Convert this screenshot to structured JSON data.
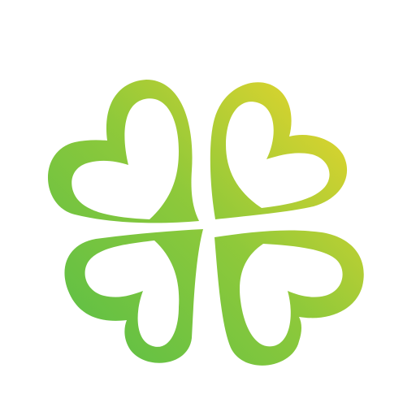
{
  "logo": {
    "icon": "four-leaf-clover-icon",
    "colors": {
      "gradient_start": "#5cbf46",
      "gradient_mid": "#8fc93a",
      "gradient_end": "#ead52c",
      "fill": "#ffffff",
      "background": "#ffffff"
    }
  }
}
